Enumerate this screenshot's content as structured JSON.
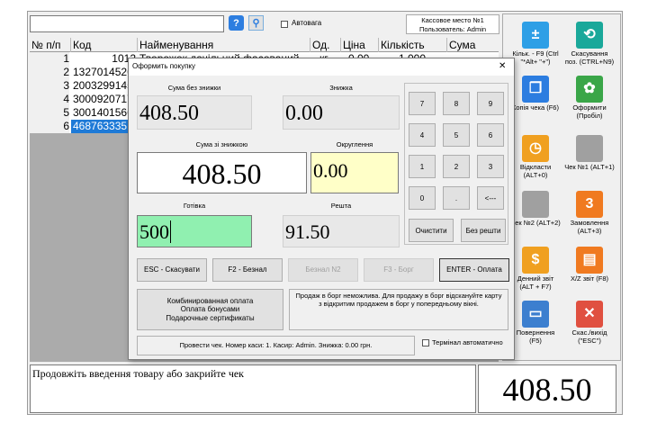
{
  "topbar": {
    "search_placeholder": "",
    "autoweight_label": "Автовага",
    "register_title": "Кассовое место №1",
    "register_user": "Пользователь: Admin"
  },
  "grid": {
    "headers": [
      "№ п/п",
      "Код",
      "Найменування",
      "Од.",
      "Ціна",
      "Кількість",
      "Сума"
    ],
    "rows": [
      {
        "n": "1",
        "code": "1012",
        "name": "Творожок дачільний фасований",
        "unit": "кг",
        "price": "0.00",
        "qty": "1.000"
      },
      {
        "n": "2",
        "code": "1327014526"
      },
      {
        "n": "3",
        "code": "2003299145"
      },
      {
        "n": "4",
        "code": "3000920717"
      },
      {
        "n": "5",
        "code": "3001401566"
      },
      {
        "n": "6",
        "code": "4687633351"
      }
    ]
  },
  "status_line": "Продовжіть введення товару або закрийте чек",
  "total_display": "408.50",
  "side_tiles": [
    {
      "label": "Кільк. - F9 (Ctrl \"*Alt+ \"+\")",
      "icon": "calculator-icon",
      "color": "#2e9fe6"
    },
    {
      "label": "Скасування поз. (CTRL+N9)",
      "icon": "refresh-icon",
      "color": "#1aa89a"
    },
    {
      "label": "Копія чека (F6)",
      "icon": "copy-icon",
      "color": "#2c7de0"
    },
    {
      "label": "Оформити (Пробіл)",
      "icon": "receipt-icon",
      "color": "#3aa648"
    },
    {
      "label": "Відкласти (ALT+0)",
      "icon": "clock-icon",
      "color": "#f0a020"
    },
    {
      "label": "Чек №1 (ALT+1)",
      "icon": "empty-icon",
      "color": "#a0a0a0"
    },
    {
      "label": "Чек №2 (ALT+2)",
      "icon": "empty-icon",
      "color": "#a0a0a0"
    },
    {
      "label": "Замовлення (ALT+3)",
      "icon": "order-3-icon",
      "color": "#f07a20"
    },
    {
      "label": "Денний звіт (ALT + F7)",
      "icon": "dollar-icon",
      "color": "#f0a020"
    },
    {
      "label": "X/Z звіт (F8)",
      "icon": "report-icon",
      "color": "#f07a20"
    },
    {
      "label": "Повернення (F5)",
      "icon": "return-icon",
      "color": "#3c7fcf"
    },
    {
      "label": "Скас./вихід (\"ESC\")",
      "icon": "close-icon",
      "color": "#e05040"
    }
  ],
  "dialog": {
    "title": "Оформить покупку",
    "close": "✕",
    "sum_no_discount_label": "Сума без знижки",
    "sum_no_discount": "408.50",
    "discount_label": "Знижка",
    "discount": "0.00",
    "sum_discount_label": "Сума зі знижкою",
    "sum_discount": "408.50",
    "rounding_label": "Округлення",
    "rounding": "0.00",
    "cash_label": "Готівка",
    "cash": "500",
    "change_label": "Решта",
    "change": "91.50",
    "keypad": [
      "7",
      "8",
      "9",
      "4",
      "5",
      "6",
      "1",
      "2",
      "3",
      "0",
      ".",
      "<---"
    ],
    "clear": "Очистити",
    "no_change": "Без решти",
    "btn_cancel": "ESC - Скасувати",
    "btn_cashless": "F2 - Безнал",
    "btn_cashless2": "Безнал N2",
    "btn_debt": "F3 - Борг",
    "btn_pay": "ENTER - Оплата",
    "combo": [
      "Комбинированная оплата",
      "Оплата бонусами",
      "Подарочные сертификаты"
    ],
    "debt_notice": "Продаж в борг неможлива. Для продажу в борг відскануйте карту з відкритим продажем в борг у попередньому вікні.",
    "status": "Провести чек. Номер каси: 1. Касир: Admin. Знижка: 0.00 грн.",
    "terminal_auto": "Термінал автоматично"
  }
}
